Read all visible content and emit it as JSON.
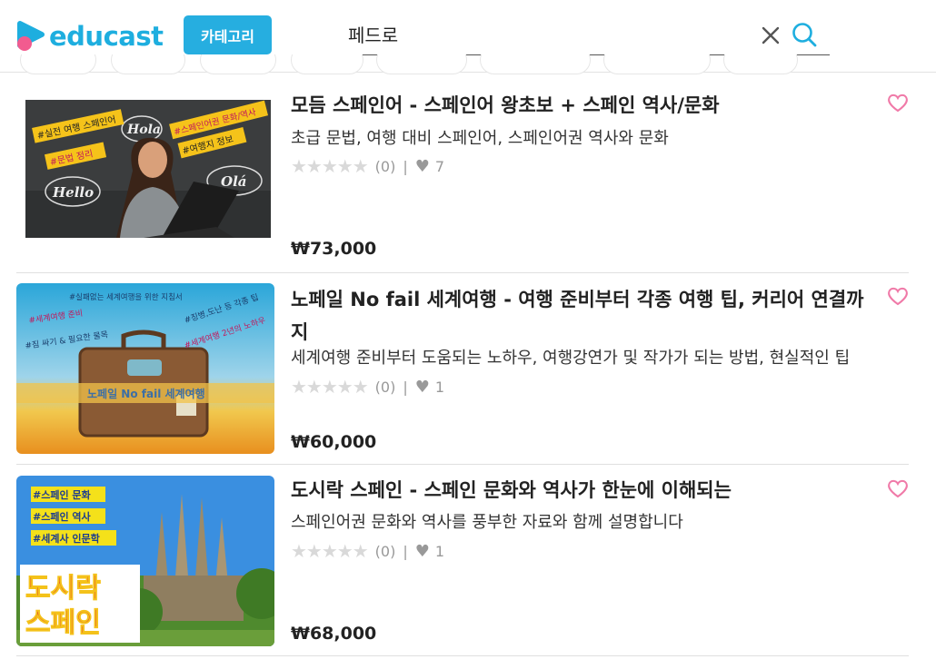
{
  "header": {
    "logo_text": "educast",
    "category_button": "카테고리",
    "search_value": "페드로"
  },
  "courses": [
    {
      "title": "모듬 스페인어 - 스페인어 왕초보 + 스페인 역사/문화",
      "subtitle": "초급 문법, 여행 대비 스페인어, 스페인어권 역사와 문화",
      "stars": "★★★★★",
      "rating_count": "(0)",
      "separator": "|",
      "likes": "7",
      "price": "₩73,000",
      "thumb_tags": [
        "#실전 여행 스페인어",
        "#문법 정리",
        "#스페인어권 문화/역사",
        "#여행지 정보"
      ],
      "thumb_words": [
        "Hola",
        "Hello",
        "Olá"
      ]
    },
    {
      "title": "노페일 No fail 세계여행 - 여행 준비부터 각종 여행 팁, 커리어 연결까지",
      "subtitle": "세계여행 준비부터 도움되는 노하우, 여행강연가 및 작가가 되는 방법, 현실적인 팁",
      "stars": "★★★★★",
      "rating_count": "(0)",
      "separator": "|",
      "likes": "1",
      "price": "₩60,000",
      "thumb_tags": [
        "#실패없는 세계여행을 위한 지침서",
        "#세계여행 준비",
        "#짐 싸기 & 필요한 물목",
        "#징병,도난 등 각종 팁",
        "#세계여행 2년의 노하우"
      ],
      "thumb_caption": "노페일 No fail 세계여행"
    },
    {
      "title": "도시락 스페인 - 스페인 문화와 역사가 한눈에 이해되는",
      "subtitle": "스페인어권 문화와 역사를 풍부한 자료와 함께 설명합니다",
      "stars": "★★★★★",
      "rating_count": "(0)",
      "separator": "|",
      "likes": "1",
      "price": "₩68,000",
      "thumb_tags": [
        "#스페인 문화",
        "#스페인 역사",
        "#세계사 인문학"
      ],
      "thumb_title_lines": [
        "도시락",
        "스페인"
      ]
    }
  ],
  "colors": {
    "brand": "#1eaedf",
    "logo_pink": "#f25b8f",
    "wish_heart": "#f07aa8",
    "star_empty": "#d9d9d9"
  },
  "icons": [
    "clear-icon",
    "search-icon",
    "heart-outline-icon",
    "heart-filled-icon",
    "star-icon"
  ]
}
